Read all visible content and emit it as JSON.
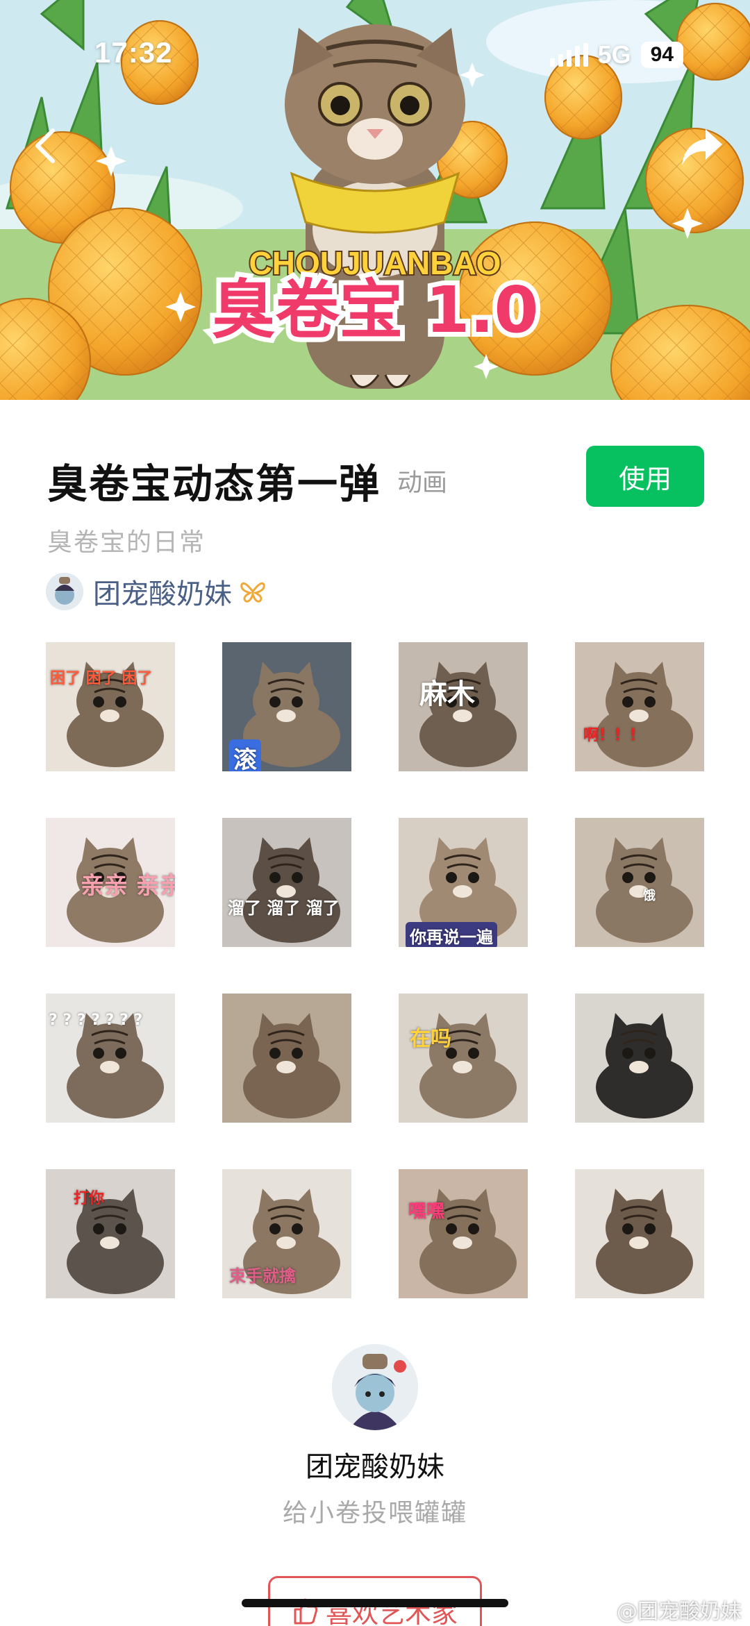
{
  "status_bar": {
    "time": "17:32",
    "network": "5G",
    "battery": "94"
  },
  "banner": {
    "title_latin": "CHOUJUANBAO",
    "title_cn": "臭卷宝 1.0"
  },
  "pack": {
    "title": "臭卷宝动态第一弹",
    "type_tag": "动画",
    "use_button": "使用",
    "description": "臭卷宝的日常",
    "author": "团宠酸奶妹"
  },
  "stickers": [
    {
      "caption": "困了 困了 困了"
    },
    {
      "caption": "滚"
    },
    {
      "caption": "麻木"
    },
    {
      "caption": "啊！！！"
    },
    {
      "caption": "亲亲 亲亲"
    },
    {
      "caption": "溜了 溜了 溜了"
    },
    {
      "caption": "你再说一遍"
    },
    {
      "caption": "饿"
    },
    {
      "caption": "? ? ? ? ? ? ?"
    },
    {
      "caption": ""
    },
    {
      "caption": "在吗"
    },
    {
      "caption": ""
    },
    {
      "caption": "打你"
    },
    {
      "caption": "束手就擒"
    },
    {
      "caption": "嘿嘿"
    },
    {
      "caption": ""
    }
  ],
  "artist": {
    "name": "团宠酸奶妹",
    "slogan": "给小卷投喂罐罐",
    "like_button": "喜欢艺术家"
  },
  "watermark": "@团宠酸奶妹",
  "colors": {
    "primary_green": "#07c160",
    "like_red": "#e05656",
    "author_blue": "#4a5f86"
  }
}
